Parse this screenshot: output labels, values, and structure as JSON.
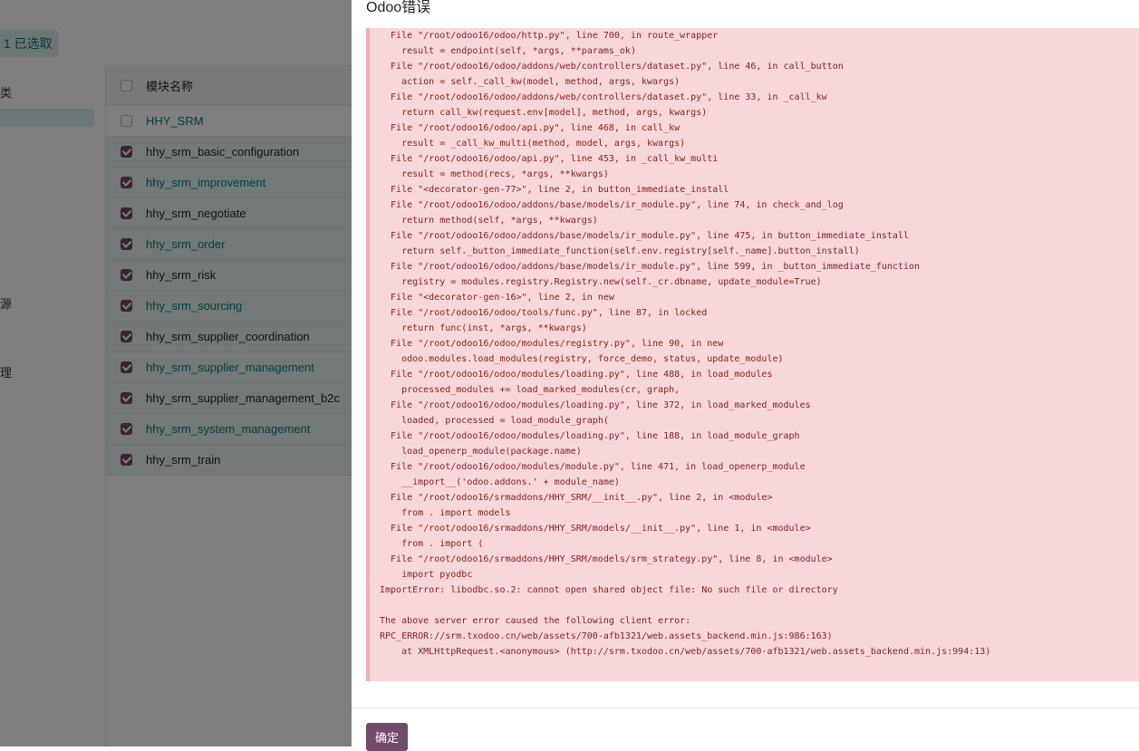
{
  "background": {
    "selected_count": "1 已选取",
    "filter_fragments": [
      "类",
      "源",
      "理"
    ],
    "table": {
      "header": "模块名称",
      "rows": [
        {
          "name": "HHY_SRM",
          "checked": false
        },
        {
          "name": "hhy_srm_basic_configuration",
          "checked": true
        },
        {
          "name": "hhy_srm_improvement",
          "checked": true
        },
        {
          "name": "hhy_srm_negotiate",
          "checked": true
        },
        {
          "name": "hhy_srm_order",
          "checked": true
        },
        {
          "name": "hhy_srm_risk",
          "checked": true
        },
        {
          "name": "hhy_srm_sourcing",
          "checked": true
        },
        {
          "name": "hhy_srm_supplier_coordination",
          "checked": true
        },
        {
          "name": "hhy_srm_supplier_management",
          "checked": true
        },
        {
          "name": "hhy_srm_supplier_management_b2c",
          "checked": true
        },
        {
          "name": "hhy_srm_system_management",
          "checked": true
        },
        {
          "name": "hhy_srm_train",
          "checked": true
        }
      ]
    }
  },
  "dialog": {
    "title": "Odoo错误",
    "traceback": [
      "  File \"/root/odoo16/odoo/http.py\", line 700, in route_wrapper",
      "    result = endpoint(self, *args, **params_ok)",
      "  File \"/root/odoo16/odoo/addons/web/controllers/dataset.py\", line 46, in call_button",
      "    action = self._call_kw(model, method, args, kwargs)",
      "  File \"/root/odoo16/odoo/addons/web/controllers/dataset.py\", line 33, in _call_kw",
      "    return call_kw(request.env[model], method, args, kwargs)",
      "  File \"/root/odoo16/odoo/api.py\", line 468, in call_kw",
      "    result = _call_kw_multi(method, model, args, kwargs)",
      "  File \"/root/odoo16/odoo/api.py\", line 453, in _call_kw_multi",
      "    result = method(recs, *args, **kwargs)",
      "  File \"<decorator-gen-77>\", line 2, in button_immediate_install",
      "  File \"/root/odoo16/odoo/addons/base/models/ir_module.py\", line 74, in check_and_log",
      "    return method(self, *args, **kwargs)",
      "  File \"/root/odoo16/odoo/addons/base/models/ir_module.py\", line 475, in button_immediate_install",
      "    return self._button_immediate_function(self.env.registry[self._name].button_install)",
      "  File \"/root/odoo16/odoo/addons/base/models/ir_module.py\", line 599, in _button_immediate_function",
      "    registry = modules.registry.Registry.new(self._cr.dbname, update_module=True)",
      "  File \"<decorator-gen-16>\", line 2, in new",
      "  File \"/root/odoo16/odoo/tools/func.py\", line 87, in locked",
      "    return func(inst, *args, **kwargs)",
      "  File \"/root/odoo16/odoo/modules/registry.py\", line 90, in new",
      "    odoo.modules.load_modules(registry, force_demo, status, update_module)",
      "  File \"/root/odoo16/odoo/modules/loading.py\", line 488, in load_modules",
      "    processed_modules += load_marked_modules(cr, graph,",
      "  File \"/root/odoo16/odoo/modules/loading.py\", line 372, in load_marked_modules",
      "    loaded, processed = load_module_graph(",
      "  File \"/root/odoo16/odoo/modules/loading.py\", line 188, in load_module_graph",
      "    load_openerp_module(package.name)",
      "  File \"/root/odoo16/odoo/modules/module.py\", line 471, in load_openerp_module",
      "    __import__('odoo.addons.' + module_name)",
      "  File \"/root/odoo16/srmaddons/HHY_SRM/__init__.py\", line 2, in <module>",
      "    from . import models",
      "  File \"/root/odoo16/srmaddons/HHY_SRM/models/__init__.py\", line 1, in <module>",
      "    from . import (",
      "  File \"/root/odoo16/srmaddons/HHY_SRM/models/srm_strategy.py\", line 8, in <module>",
      "    import pyodbc",
      "ImportError: libodbc.so.2: cannot open shared object file: No such file or directory",
      "",
      "The above server error caused the following client error:",
      "RPC_ERROR://srm.txodoo.cn/web/assets/700-afb1321/web.assets_backend.min.js:986:163)",
      "    at XMLHttpRequest.<anonymous> (http://srm.txodoo.cn/web/assets/700-afb1321/web.assets_backend.min.js:994:13)"
    ],
    "ok_label": "确定"
  },
  "colors": {
    "primary": "#714b67",
    "teal_link": "#017e84",
    "error_bg": "#f8d7da",
    "error_text": "#842029"
  }
}
